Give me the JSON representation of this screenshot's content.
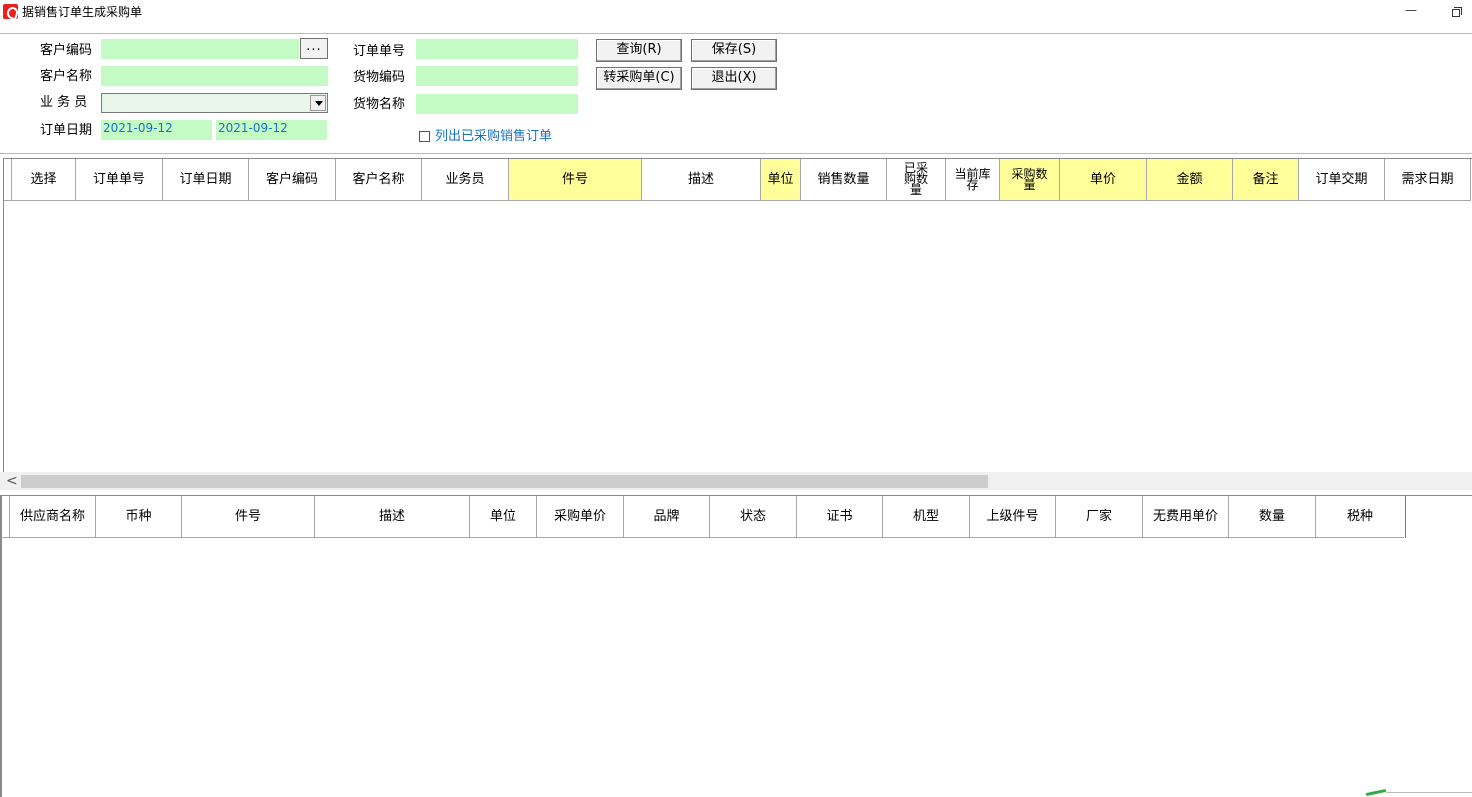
{
  "window": {
    "title": "据销售订单生成采购单",
    "minimize_glyph": "—"
  },
  "form": {
    "customer_code_label": "客户编码",
    "customer_name_label": "客户名称",
    "salesman_label": "业 务 员",
    "order_date_label": "订单日期",
    "order_no_label": "订单单号",
    "goods_code_label": "货物编码",
    "goods_name_label": "货物名称",
    "date_from": "2021-09-12",
    "date_to": "2021-09-12",
    "lookup_button": "...",
    "show_purchased_label": "列出已采购销售订单"
  },
  "buttons": {
    "query": "查询(R)",
    "save": "保存(S)",
    "to_purchase": "转采购单(C)",
    "exit": "退出(X)"
  },
  "sales_grid": {
    "columns": [
      "选择",
      "订单单号",
      "订单日期",
      "客户编码",
      "客户名称",
      "业务员",
      "件号",
      "描述",
      "单位",
      "销售数量",
      "已采购数量",
      "当前库存",
      "采购数量",
      "单价",
      "金额",
      "备注",
      "订单交期",
      "需求日期"
    ]
  },
  "supplier_grid": {
    "columns": [
      "供应商名称",
      "币种",
      "件号",
      "描述",
      "单位",
      "采购单价",
      "品牌",
      "状态",
      "证书",
      "机型",
      "上级件号",
      "厂家",
      "无费用单价",
      "数量",
      "税种"
    ]
  },
  "scrollbar": {
    "left_arrow": "<"
  },
  "colors": {
    "field_bg": "#c4fbc4",
    "highlight_header": "#ffff99",
    "date_text": "#1a73c2",
    "checkbox_label": "#1a73c2"
  }
}
